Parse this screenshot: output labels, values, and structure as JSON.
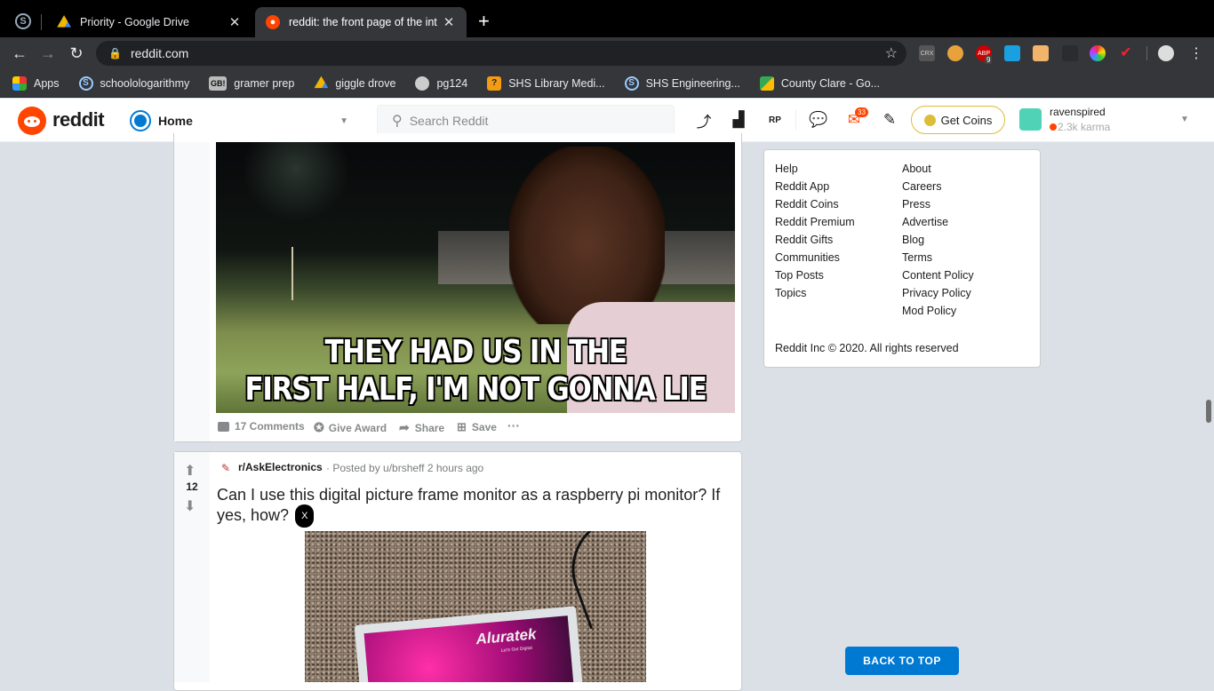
{
  "browser": {
    "tabs": [
      {
        "title": "Priority - Google Drive",
        "close": "✕"
      },
      {
        "title": "reddit: the front page of the int",
        "close": "✕"
      }
    ],
    "new_tab": "+",
    "url": "reddit.com",
    "extensions": [
      "CRX",
      "ABP"
    ],
    "abp_badge": "9",
    "bookmarks": [
      {
        "label": "Apps"
      },
      {
        "label": "schoolologarithmy"
      },
      {
        "label": "gramer prep",
        "icon_text": "GB!"
      },
      {
        "label": "giggle drove"
      },
      {
        "label": "pg124"
      },
      {
        "label": "SHS Library Medi..."
      },
      {
        "label": "SHS Engineering..."
      },
      {
        "label": "County Clare - Go..."
      }
    ]
  },
  "reddit_header": {
    "logo_text": "reddit",
    "feed": "Home",
    "search_placeholder": "Search Reddit",
    "mail_badge": "33",
    "get_coins": "Get Coins",
    "username": "ravenspired",
    "karma": "2.3k karma"
  },
  "post1": {
    "meme_caption_line1": "THEY HAD US IN THE",
    "meme_caption_line2": "FIRST HALF, I'M NOT GONNA LIE",
    "comments": "17 Comments",
    "give_award": "Give Award",
    "share": "Share",
    "save": "Save",
    "more": "···"
  },
  "post2": {
    "score": "12",
    "subreddit": "r/AskElectronics",
    "posted_by": "· Posted by u/brsheff 2 hours ago",
    "title": "Can I use this digital picture frame monitor as a raspberry pi monitor? If yes, how?",
    "flair": "X",
    "image_brand": "Aluratek",
    "image_tagline": "Let's Get Digital"
  },
  "sidebar": {
    "col1": [
      "Help",
      "Reddit App",
      "Reddit Coins",
      "Reddit Premium",
      "Reddit Gifts",
      "Communities",
      "Top Posts",
      "Topics"
    ],
    "col2": [
      "About",
      "Careers",
      "Press",
      "Advertise",
      "Blog",
      "Terms",
      "Content Policy",
      "Privacy Policy",
      "Mod Policy"
    ],
    "copyright": "Reddit Inc © 2020. All rights reserved"
  },
  "back_to_top": "BACK TO TOP",
  "colors": {
    "reddit_orange": "#ff4500",
    "reddit_blue": "#0079d3",
    "coin_gold": "#ddbd37"
  }
}
